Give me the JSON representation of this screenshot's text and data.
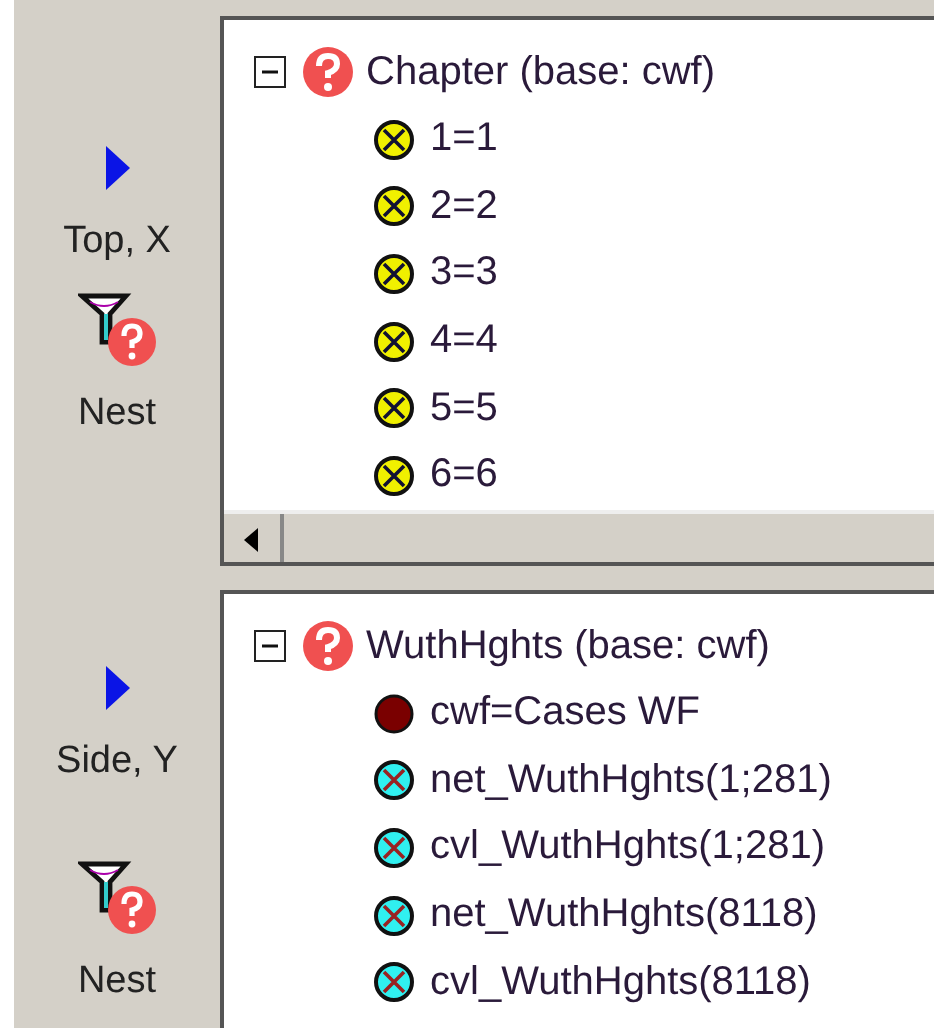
{
  "sidebar": [
    {
      "label": "Top, X",
      "nest_label": "Nest"
    },
    {
      "label": "Side, Y",
      "nest_label": "Nest"
    }
  ],
  "panels": [
    {
      "title": "Chapter (base: cwf)",
      "expanded": true,
      "scrollbar": true,
      "items": [
        {
          "kind": "code",
          "label": "1=1"
        },
        {
          "kind": "code",
          "label": "2=2"
        },
        {
          "kind": "code",
          "label": "3=3"
        },
        {
          "kind": "code",
          "label": "4=4"
        },
        {
          "kind": "code",
          "label": "5=5"
        },
        {
          "kind": "code",
          "label": "6=6"
        }
      ]
    },
    {
      "title": "WuthHghts (base: cwf)",
      "expanded": true,
      "scrollbar": false,
      "items": [
        {
          "kind": "base",
          "label": "cwf=Cases WF"
        },
        {
          "kind": "variable",
          "label": "net_WuthHghts(1;281)"
        },
        {
          "kind": "variable",
          "label": "cvl_WuthHghts(1;281)"
        },
        {
          "kind": "variable",
          "label": "net_WuthHghts(8118)"
        },
        {
          "kind": "variable",
          "label": "cvl_WuthHghts(8118)"
        }
      ]
    }
  ]
}
